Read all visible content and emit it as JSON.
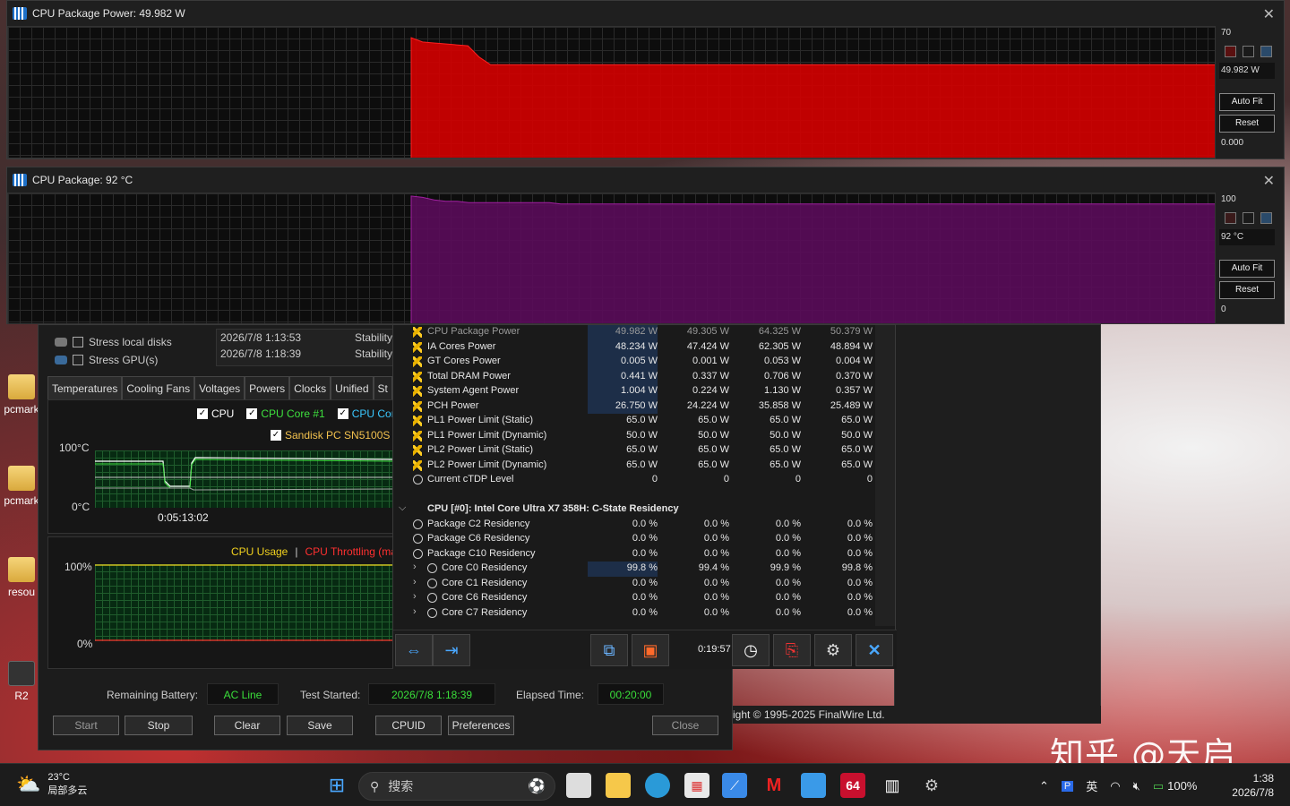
{
  "colors": {
    "power_fill": "#d40000",
    "temp_fill": "#5a0b5a",
    "green_value": "#3adf3a",
    "accent_blue": "#1d2e48"
  },
  "power_graph": {
    "title": "CPU Package Power: 49.982 W",
    "max_label": "70",
    "current_value": "49.982 W",
    "min_label": "0.000",
    "auto_fit_label": "Auto Fit",
    "reset_label": "Reset",
    "max": 70,
    "series": [
      0,
      0,
      0,
      0,
      0,
      0,
      0,
      0,
      0,
      0,
      0,
      0,
      0,
      0,
      0,
      0,
      0,
      0,
      0,
      0,
      0,
      0,
      0,
      0,
      0,
      0,
      0,
      0,
      0,
      0,
      0,
      0,
      0,
      0,
      0,
      0,
      64.3,
      62,
      61.5,
      61,
      60.5,
      60,
      54,
      50,
      50,
      50,
      50,
      50,
      50,
      50,
      50,
      50,
      50,
      50,
      50,
      50,
      50,
      50,
      50,
      50,
      50,
      50,
      50,
      50,
      50,
      50,
      50,
      50,
      50,
      50,
      50,
      50,
      50,
      50,
      50,
      50,
      50,
      50,
      50,
      50,
      50,
      50,
      50,
      50,
      50,
      50,
      50,
      50,
      50,
      50,
      50,
      50,
      50,
      50,
      50,
      50,
      50,
      50,
      50,
      50,
      50,
      50,
      50,
      50,
      50,
      50,
      50
    ]
  },
  "temp_graph": {
    "title": "CPU Package: 92 °C",
    "max_label": "100",
    "current_value": "92 °C",
    "min_label": "0",
    "auto_fit_label": "Auto Fit",
    "reset_label": "Reset",
    "max": 100,
    "series": [
      0,
      0,
      0,
      0,
      0,
      0,
      0,
      0,
      0,
      0,
      0,
      0,
      0,
      0,
      0,
      0,
      0,
      0,
      0,
      0,
      0,
      0,
      0,
      0,
      0,
      0,
      0,
      0,
      0,
      0,
      0,
      0,
      0,
      0,
      0,
      0,
      98,
      97,
      95,
      94,
      94,
      93,
      93,
      93,
      93,
      93,
      93,
      93,
      93,
      92,
      92,
      92,
      92,
      92,
      92,
      92,
      92,
      92,
      92,
      92,
      92,
      92,
      92,
      92,
      92,
      92,
      92,
      92,
      92,
      92,
      92,
      92,
      92,
      92,
      92,
      92,
      92,
      92,
      92,
      92,
      92,
      92,
      92,
      92,
      92,
      92,
      92,
      92,
      92,
      92,
      92,
      92,
      92,
      92,
      92,
      92,
      92,
      92,
      92,
      92,
      92,
      92,
      92,
      92,
      92,
      92
    ]
  },
  "desktop_icons": [
    "pcmark",
    "pcmark",
    "resou",
    "R2"
  ],
  "stability": {
    "options": [
      {
        "label": "Stress local disks",
        "checked": false
      },
      {
        "label": "Stress GPU(s)",
        "checked": false
      }
    ],
    "log": [
      {
        "time": "2026/7/8 1:13:53",
        "status": "Stability"
      },
      {
        "time": "2026/7/8 1:18:39",
        "status": "Stability"
      }
    ],
    "tabs": [
      "Temperatures",
      "Cooling Fans",
      "Voltages",
      "Powers",
      "Clocks",
      "Unified",
      "St"
    ],
    "temp_legend": [
      "CPU",
      "CPU Core #1",
      "CPU Core #",
      "Sandisk PC SN5100S SI"
    ],
    "temp_axis_top": "100°C",
    "temp_axis_bottom": "0°C",
    "temp_time_label": "0:05:13:02",
    "usage_legend_1": "CPU Usage",
    "usage_sep": "|",
    "usage_legend_2": "CPU Throttling (max",
    "usage_axis_top": "100%",
    "usage_axis_bottom": "0%",
    "battery_label": "Remaining Battery:",
    "battery_value": "AC Line",
    "test_started_label": "Test Started:",
    "test_started_value": "2026/7/8 1:18:39",
    "elapsed_label": "Elapsed Time:",
    "elapsed_value": "00:20:00",
    "buttons": {
      "start": "Start",
      "stop": "Stop",
      "clear": "Clear",
      "save": "Save",
      "cpuid": "CPUID",
      "preferences": "Preferences",
      "close": "Close"
    }
  },
  "hwinfo": {
    "rows": [
      {
        "type": "bolt",
        "name": "CPU Package Power",
        "v": [
          "49.982 W",
          "49.305 W",
          "64.325 W",
          "50.379 W"
        ],
        "hl": true,
        "dim": true
      },
      {
        "type": "bolt",
        "name": "IA Cores Power",
        "v": [
          "48.234 W",
          "47.424 W",
          "62.305 W",
          "48.894 W"
        ],
        "hl": true
      },
      {
        "type": "bolt",
        "name": "GT Cores Power",
        "v": [
          "0.005 W",
          "0.001 W",
          "0.053 W",
          "0.004 W"
        ],
        "hl": true
      },
      {
        "type": "bolt",
        "name": "Total DRAM Power",
        "v": [
          "0.441 W",
          "0.337 W",
          "0.706 W",
          "0.370 W"
        ],
        "hl": true
      },
      {
        "type": "bolt",
        "name": "System Agent Power",
        "v": [
          "1.004 W",
          "0.224 W",
          "1.130 W",
          "0.357 W"
        ],
        "hl": true
      },
      {
        "type": "bolt",
        "name": "PCH Power",
        "v": [
          "26.750 W",
          "24.224 W",
          "35.858 W",
          "25.489 W"
        ],
        "hl": true
      },
      {
        "type": "bolt",
        "name": "PL1 Power Limit (Static)",
        "v": [
          "65.0 W",
          "65.0 W",
          "65.0 W",
          "65.0 W"
        ]
      },
      {
        "type": "bolt",
        "name": "PL1 Power Limit (Dynamic)",
        "v": [
          "50.0 W",
          "50.0 W",
          "50.0 W",
          "50.0 W"
        ]
      },
      {
        "type": "bolt",
        "name": "PL2 Power Limit (Static)",
        "v": [
          "65.0 W",
          "65.0 W",
          "65.0 W",
          "65.0 W"
        ]
      },
      {
        "type": "bolt",
        "name": "PL2 Power Limit (Dynamic)",
        "v": [
          "65.0 W",
          "65.0 W",
          "65.0 W",
          "65.0 W"
        ]
      },
      {
        "type": "clock",
        "name": "Current cTDP Level",
        "v": [
          "0",
          "0",
          "0",
          "0"
        ]
      },
      {
        "type": "blank",
        "name": "",
        "v": [
          "",
          "",
          "",
          ""
        ]
      },
      {
        "type": "header",
        "name": "CPU [#0]: Intel Core Ultra X7 358H: C-State Residency",
        "v": [
          "",
          "",
          "",
          ""
        ]
      },
      {
        "type": "clock",
        "name": "Package C2 Residency",
        "v": [
          "0.0 %",
          "0.0 %",
          "0.0 %",
          "0.0 %"
        ]
      },
      {
        "type": "clock",
        "name": "Package C6 Residency",
        "v": [
          "0.0 %",
          "0.0 %",
          "0.0 %",
          "0.0 %"
        ]
      },
      {
        "type": "clock",
        "name": "Package C10 Residency",
        "v": [
          "0.0 %",
          "0.0 %",
          "0.0 %",
          "0.0 %"
        ]
      },
      {
        "type": "sub",
        "name": "Core C0 Residency",
        "v": [
          "99.8 %",
          "99.4 %",
          "99.9 %",
          "99.8 %"
        ],
        "hl": true
      },
      {
        "type": "sub",
        "name": "Core C1 Residency",
        "v": [
          "0.0 %",
          "0.0 %",
          "0.0 %",
          "0.0 %"
        ]
      },
      {
        "type": "sub",
        "name": "Core C6 Residency",
        "v": [
          "0.0 %",
          "0.0 %",
          "0.0 %",
          "0.0 %"
        ]
      },
      {
        "type": "sub",
        "name": "Core C7 Residency",
        "v": [
          "0.0 %",
          "0.0 %",
          "0.0 %",
          "0.0 %"
        ]
      }
    ],
    "timer": "0:19:57",
    "copyright": "ight © 1995-2025 FinalWire Ltd."
  },
  "taskbar": {
    "weather_temp": "23°C",
    "weather_desc": "局部多云",
    "search_placeholder": "搜索",
    "ime": "英",
    "battery": "100%",
    "time": "1:38",
    "date": "2026/7/8",
    "badge_64": "64"
  },
  "watermark": "知乎 @天启"
}
